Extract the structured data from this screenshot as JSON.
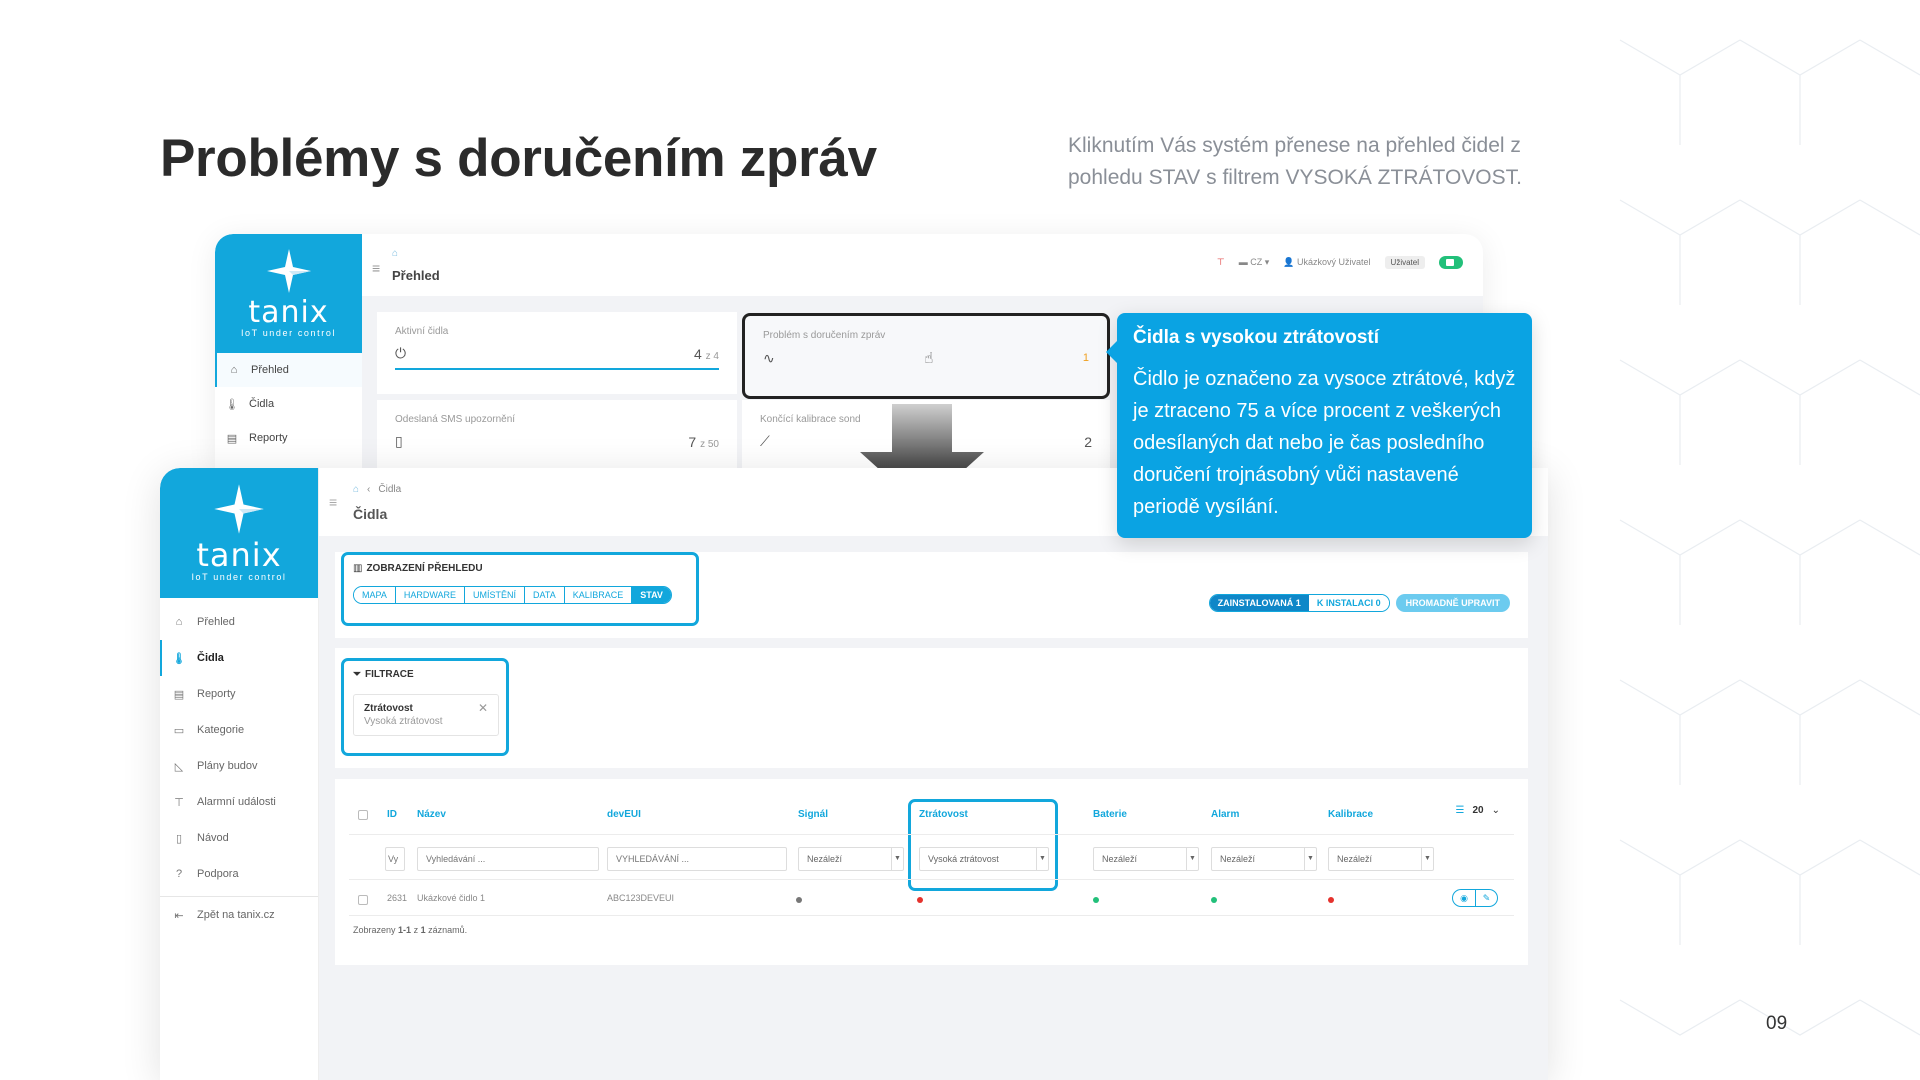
{
  "slide": {
    "title": "Problémy s doručením zpráv",
    "description": "Kliknutím Vás systém přenese na přehled čidel z pohledu STAV s filtrem VYSOKÁ ZTRÁTOVOST.",
    "page_number": "09"
  },
  "colors": {
    "accent": "#12a7dc",
    "tooltip": "#0aa3e3",
    "ok": "#22c07a",
    "error": "#e5322d",
    "neutral": "#777777"
  },
  "brand": {
    "name": "tanix",
    "tagline": "IoT under control"
  },
  "back_app": {
    "page_title": "Přehled",
    "sidebar": [
      {
        "label": "Přehled",
        "icon": "home-icon"
      },
      {
        "label": "Čidla",
        "icon": "thermometer-icon"
      },
      {
        "label": "Reporty",
        "icon": "report-icon"
      }
    ],
    "header": {
      "lang": "CZ",
      "user": "Ukázkový Uživatel",
      "role": "Uživatel"
    },
    "cards": {
      "active": {
        "label": "Aktivní čidla",
        "value": "4",
        "total": "z 4"
      },
      "problem": {
        "label": "Problém s doručením zpráv",
        "value": "1"
      },
      "sms": {
        "label": "Odeslaná SMS upozornění",
        "value": "7",
        "total": "z 50"
      },
      "calib": {
        "label": "Končící kalibrace sond",
        "value": "2"
      }
    }
  },
  "front_app": {
    "breadcrumb": "Čidla",
    "page_title": "Čidla",
    "sidebar": [
      {
        "label": "Přehled",
        "icon": "home-icon"
      },
      {
        "label": "Čidla",
        "icon": "thermometer-icon"
      },
      {
        "label": "Reporty",
        "icon": "report-icon"
      },
      {
        "label": "Kategorie",
        "icon": "folder-icon"
      },
      {
        "label": "Plány budov",
        "icon": "floorplan-icon"
      },
      {
        "label": "Alarmní události",
        "icon": "antenna-icon"
      },
      {
        "label": "Návod",
        "icon": "book-icon"
      },
      {
        "label": "Podpora",
        "icon": "help-icon"
      }
    ],
    "back_link": "Zpět na tanix.cz",
    "view": {
      "title": "ZOBRAZENÍ PŘEHLEDU",
      "tabs": [
        "MAPA",
        "HARDWARE",
        "UMÍSTĚNÍ",
        "DATA",
        "KALIBRACE",
        "STAV"
      ],
      "active_tab": "STAV"
    },
    "status": {
      "installed": "ZAINSTALOVANÁ 1",
      "to_install": "K INSTALACI 0",
      "bulk_edit": "HROMADNĚ UPRAVIT"
    },
    "filter": {
      "title": "FILTRACE",
      "key": "Ztrátovost",
      "value": "Vysoká ztrátovost"
    },
    "table": {
      "columns": [
        "ID",
        "Název",
        "devEUI",
        "Signál",
        "Ztrátovost",
        "Baterie",
        "Alarm",
        "Kalibrace"
      ],
      "per_page": "20",
      "filters": {
        "id_placeholder": "Vy",
        "name_placeholder": "Vyhledávání ...",
        "deveui_placeholder": "VYHLEDÁVÁNÍ ...",
        "signal": "Nezáleží",
        "loss": "Vysoká ztrátovost",
        "battery": "Nezáleží",
        "alarm": "Nezáleží",
        "calibration": "Nezáleží"
      },
      "rows": [
        {
          "id": "2631",
          "name": "Ukázkové čidlo 1",
          "deveui": "ABC123DEVEUI",
          "signal": "neutral",
          "loss": "error",
          "battery": "ok",
          "alarm": "ok",
          "calibration": "error"
        }
      ],
      "summary_prefix": "Zobrazeny",
      "summary_range": "1-1",
      "summary_mid": "z",
      "summary_total": "1",
      "summary_suffix": "záznamů."
    }
  },
  "tooltip": {
    "title": "Čidla s vysokou ztrátovostí",
    "body": "Čidlo je označeno za vysoce ztrátové, když je ztraceno 75 a více procent z veškerých odesílaných dat nebo je čas posledního doručení trojnásobný vůči nastavené periodě vysílání."
  }
}
